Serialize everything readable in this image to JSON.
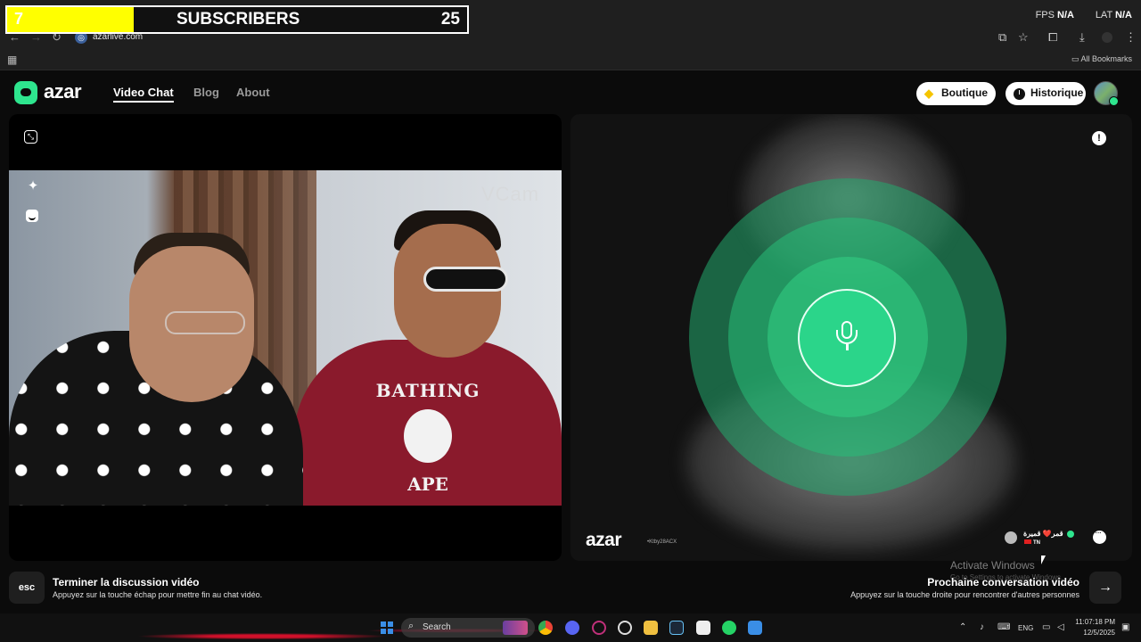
{
  "overlay": {
    "count": "7",
    "label": "SUBSCRIBERS",
    "goal": "25"
  },
  "stats": {
    "fps_label": "FPS",
    "fps_value": "N/A",
    "lat_label": "LAT",
    "lat_value": "N/A"
  },
  "browser": {
    "url": "azarlive.com",
    "all_bookmarks": "All Bookmarks"
  },
  "header": {
    "logo": "azar",
    "nav": [
      "Video Chat",
      "Blog",
      "About"
    ],
    "boutique": "Boutique",
    "historique": "Historique"
  },
  "left_video": {
    "watermark": "VCam",
    "shirt_top": "BATHING",
    "shirt_bottom": "APE"
  },
  "right_video": {
    "logo": "azar",
    "user_id": "•Ktby28ACX",
    "peer_name": "قمر❤️ قميرة",
    "peer_country": "TN"
  },
  "footer": {
    "esc_key": "esc",
    "end_title": "Terminer la discussion vidéo",
    "end_desc": "Appuyez sur la touche échap pour mettre fin au chat vidéo.",
    "next_title": "Prochaine conversation vidéo",
    "next_desc": "Appuyez sur la touche droite pour rencontrer d'autres personnes",
    "next_key": "→"
  },
  "windows_watermark": {
    "title": "Activate Windows",
    "sub": "Go to Settings to activate Windows."
  },
  "taskbar": {
    "search": "Search",
    "lang": "ENG",
    "time": "11:07:18 PM",
    "date": "12/5/2025"
  },
  "colors": {
    "accent": "#2ee58e",
    "overlay_yellow": "#ffff00",
    "shirt": "#8a1a2c"
  }
}
